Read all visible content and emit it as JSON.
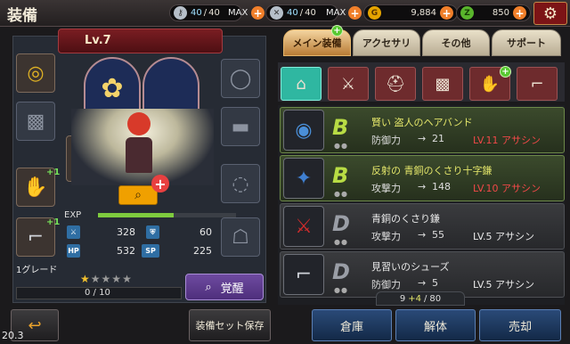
{
  "header": {
    "title": "装備",
    "stamina_current": "40",
    "stamina_sep": "/",
    "stamina_max": "40",
    "stamina_max_label": "MAX",
    "pvp_current": "40",
    "pvp_sep": "/",
    "pvp_max": "40",
    "pvp_max_label": "MAX",
    "gold": "9,884",
    "gems": "850",
    "settings_icon": "gear-icon"
  },
  "character": {
    "level": "Lv.7",
    "exp_label": "EXP",
    "exp_fraction": 0.55,
    "stats": [
      {
        "icon": "sword-icon",
        "value": "328"
      },
      {
        "icon": "shield-icon",
        "value": "60"
      },
      {
        "icon": "HP",
        "value": "532"
      },
      {
        "icon": "SP",
        "value": "225"
      }
    ],
    "grade_label": "1グレード",
    "stars_filled": 1,
    "stars_total": 5,
    "grade_progress": "0 / 10",
    "awaken_label": "覚醒",
    "equip_plus": "+1"
  },
  "tabs": {
    "main_equip": "メイン装備",
    "accessory": "アクセサリ",
    "other": "その他",
    "support": "サポート"
  },
  "filters": [
    "box-icon",
    "sword-icon",
    "helmet-icon",
    "armor-icon",
    "glove-icon",
    "boot-icon"
  ],
  "items": [
    {
      "name": "賢い 盗人のヘアバンド",
      "grade": "B",
      "stat_label": "防御力",
      "arrow": "→",
      "stat_value": "21",
      "req": "LV.11 アサシン",
      "req_color": "red",
      "selected": true,
      "icon": "headband-icon"
    },
    {
      "name": "反射の 青銅のくさり十字鎌",
      "grade": "B",
      "stat_label": "攻撃力",
      "arrow": "→",
      "stat_value": "148",
      "req": "LV.10 アサシン",
      "req_color": "red",
      "selected": true,
      "icon": "cross-sickle-icon"
    },
    {
      "name": "青銅のくさり鎌",
      "grade": "D",
      "stat_label": "攻撃力",
      "arrow": "→",
      "stat_value": "55",
      "req": "LV.5 アサシン",
      "req_color": "white",
      "selected": false,
      "icon": "sickle-icon"
    },
    {
      "name": "見習いのシューズ",
      "grade": "D",
      "stat_label": "防御力",
      "arrow": "→",
      "stat_value": "5",
      "req": "LV.5 アサシン",
      "req_color": "white",
      "selected": false,
      "icon": "shoes-icon"
    }
  ],
  "inventory_count": {
    "current": "9",
    "plus": "+4",
    "sep": "/",
    "max": "80"
  },
  "bottom": {
    "back_icon": "back-arrow-icon",
    "equip_set_save": "装備セット保存",
    "warehouse": "倉庫",
    "dismantle": "解体",
    "sell": "売却"
  },
  "version": "20.3"
}
